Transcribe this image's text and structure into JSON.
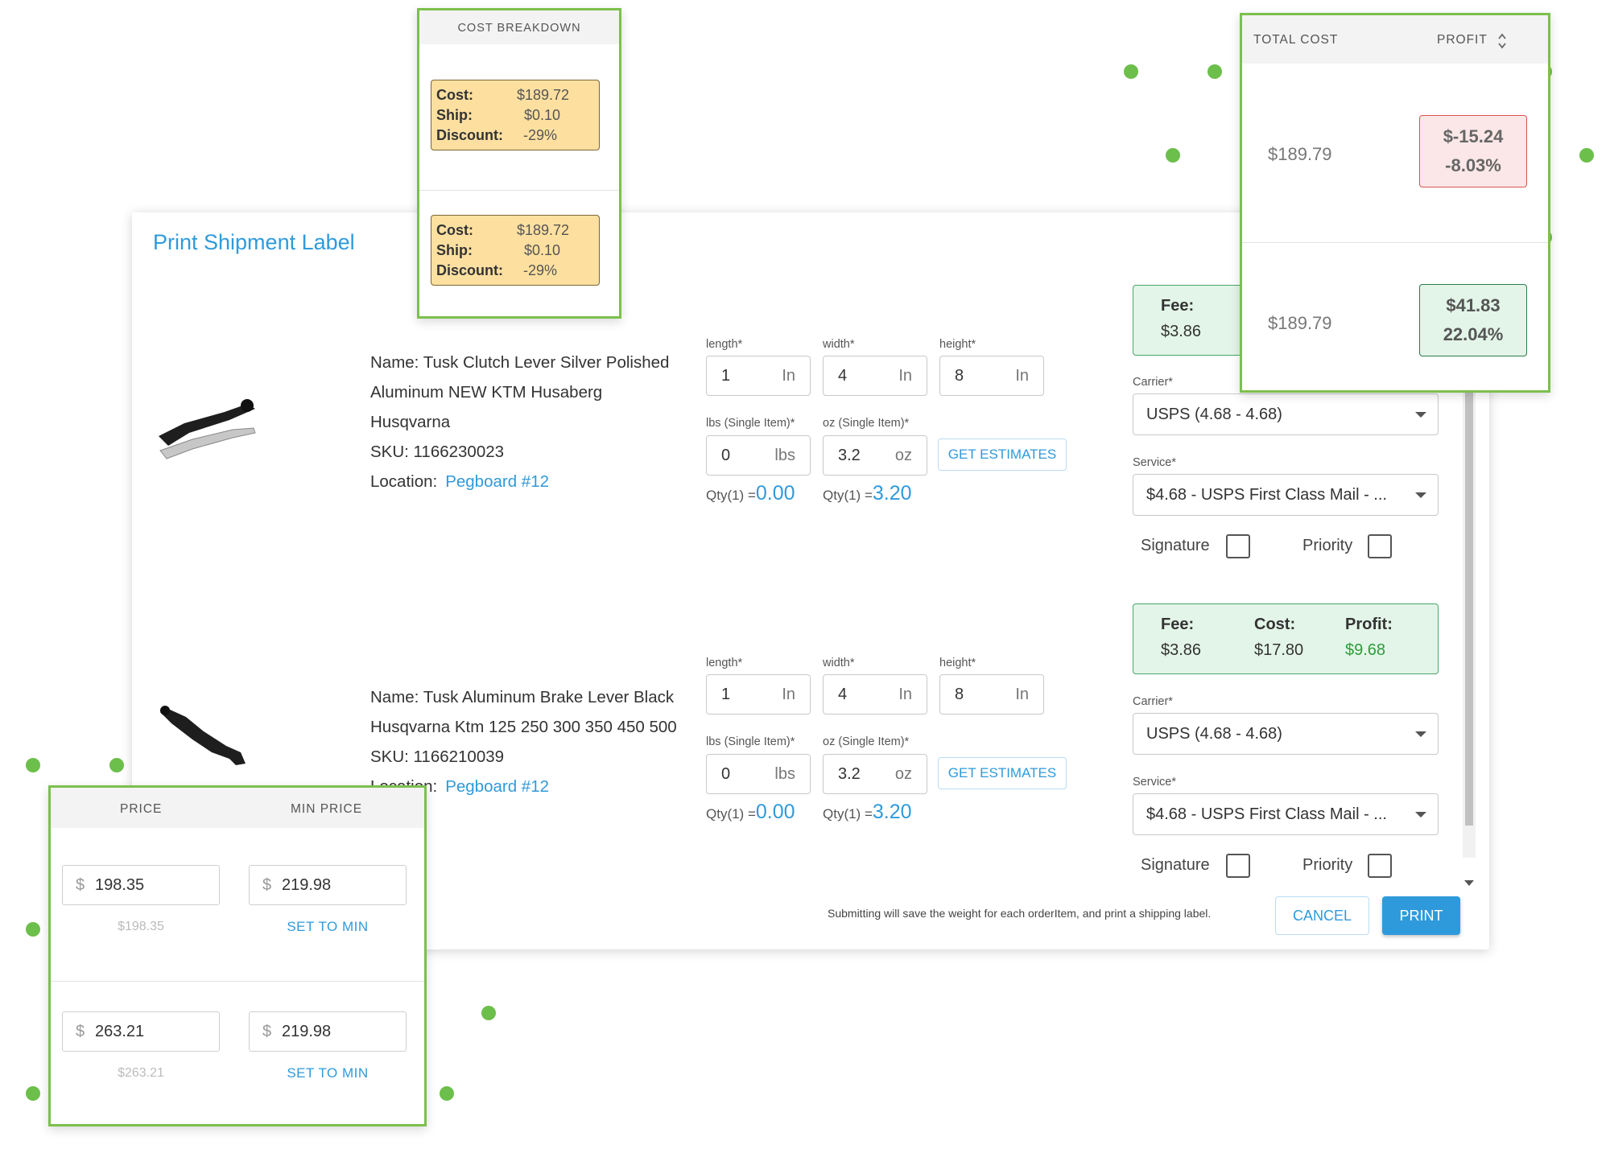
{
  "modal": {
    "title": "Print Shipment Label",
    "items": [
      {
        "name_lines": [
          "Name: Tusk Clutch Lever Silver Polished",
          "Aluminum NEW KTM Husaberg",
          "Husqvarna"
        ],
        "sku": "SKU: 1166230023",
        "location_label": "Location:",
        "location_link": "Pegboard #12",
        "length_label": "length*",
        "length": "1",
        "length_unit": "In",
        "width_label": "width*",
        "width": "4",
        "width_unit": "In",
        "height_label": "height*",
        "height": "8",
        "height_unit": "In",
        "lbs_label": "lbs (Single Item)*",
        "lbs": "0",
        "lbs_unit": "lbs",
        "oz_label": "oz (Single Item)*",
        "oz": "3.2",
        "oz_unit": "oz",
        "estimates_button": "GET ESTIMATES",
        "qty_lbs_prefix": "Qty(1) =",
        "qty_lbs_value": "0.00",
        "qty_oz_prefix": "Qty(1) =",
        "qty_oz_value": "3.20",
        "fee_label": "Fee:",
        "fee_value": "$3.86",
        "carrier_label": "Carrier*",
        "carrier_value": "USPS (4.68 - 4.68)",
        "service_label": "Service*",
        "service_value": "$4.68 - USPS First Class Mail - ...",
        "signature_label": "Signature",
        "priority_label": "Priority"
      },
      {
        "name_lines": [
          "Name: Tusk Aluminum Brake Lever Black",
          "Husqvarna Ktm 125 250 300 350 450 500"
        ],
        "sku": "SKU: 1166210039",
        "location_label": "Location:",
        "location_link": "Pegboard #12",
        "length_label": "length*",
        "length": "1",
        "length_unit": "In",
        "width_label": "width*",
        "width": "4",
        "width_unit": "In",
        "height_label": "height*",
        "height": "8",
        "height_unit": "In",
        "lbs_label": "lbs (Single Item)*",
        "lbs": "0",
        "lbs_unit": "lbs",
        "oz_label": "oz (Single Item)*",
        "oz": "3.2",
        "oz_unit": "oz",
        "estimates_button": "GET ESTIMATES",
        "qty_lbs_prefix": "Qty(1) =",
        "qty_lbs_value": "0.00",
        "qty_oz_prefix": "Qty(1) =",
        "qty_oz_value": "3.20",
        "fee_label": "Fee:",
        "fee_value": "$3.86",
        "cost_label": "Cost:",
        "cost_value": "$17.80",
        "profit_label": "Profit:",
        "profit_value": "$9.68",
        "carrier_label": "Carrier*",
        "carrier_value": "USPS (4.68 - 4.68)",
        "service_label": "Service*",
        "service_value": "$4.68 - USPS First Class Mail - ...",
        "signature_label": "Signature",
        "priority_label": "Priority"
      }
    ],
    "submit_note": "Submitting will save the weight for each orderItem, and print a shipping label.",
    "cancel_button": "CANCEL",
    "print_button": "PRINT"
  },
  "cost_breakdown": {
    "header": "COST BREAKDOWN",
    "rows": [
      {
        "cost_label": "Cost:",
        "cost": "$189.72",
        "ship_label": "Ship:",
        "ship": "$0.10",
        "discount_label": "Discount:",
        "discount": "-29%"
      },
      {
        "cost_label": "Cost:",
        "cost": "$189.72",
        "ship_label": "Ship:",
        "ship": "$0.10",
        "discount_label": "Discount:",
        "discount": "-29%"
      }
    ]
  },
  "total_cost_card": {
    "header_total": "TOTAL COST",
    "header_profit": "PROFIT",
    "sort_icon": "sort-updown-icon",
    "rows": [
      {
        "total": "$189.79",
        "profit_amount": "$-15.24",
        "profit_percent": "-8.03%",
        "status": "negative",
        "color": "#d9534f"
      },
      {
        "total": "$189.79",
        "profit_amount": "$41.83",
        "profit_percent": "22.04%",
        "status": "positive",
        "color": "#2b7a4b"
      }
    ]
  },
  "price_card": {
    "header_price": "PRICE",
    "header_min_price": "MIN PRICE",
    "currency": "$",
    "rows": [
      {
        "price": "198.35",
        "price_sub": "$198.35",
        "min_price": "219.98",
        "action": "SET TO MIN"
      },
      {
        "price": "263.21",
        "price_sub": "$263.21",
        "min_price": "219.98",
        "action": "SET TO MIN"
      }
    ]
  },
  "colors": {
    "accent": "#2f9adb",
    "card_border": "#7cc04c",
    "decor_dot": "#6cbf4b"
  }
}
